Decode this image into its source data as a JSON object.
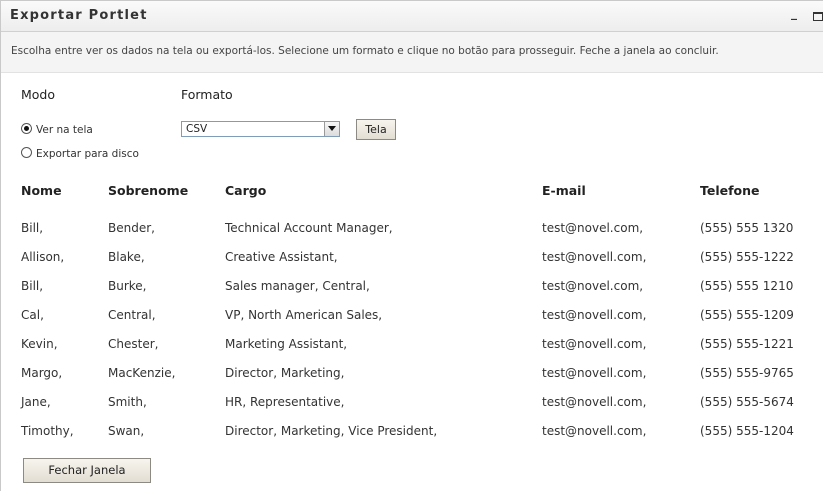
{
  "window": {
    "title": "Exportar Portlet",
    "minimize": "_"
  },
  "intro": "Escolha entre ver os dados na tela ou exportá-los. Selecione um formato e clique no botão para prosseguir. Feche a janela ao concluir.",
  "mode": {
    "label": "Modo",
    "options": [
      {
        "label": "Ver na tela",
        "selected": true
      },
      {
        "label": "Exportar para disco",
        "selected": false
      }
    ]
  },
  "format": {
    "label": "Formato",
    "selected": "CSV",
    "button": "Tela"
  },
  "table": {
    "headers": [
      "Nome",
      "Sobrenome",
      "Cargo",
      "E-mail",
      "Telefone"
    ],
    "rows": [
      [
        "Bill,",
        "Bender,",
        "Technical Account Manager,",
        "test@novel.com,",
        "(555) 555 1320"
      ],
      [
        "Allison,",
        "Blake,",
        "Creative Assistant,",
        "test@novell.com,",
        "(555) 555-1222"
      ],
      [
        "Bill,",
        "Burke,",
        "Sales manager, Central,",
        "test@novel.com,",
        "(555) 555 1210"
      ],
      [
        "Cal,",
        "Central,",
        "VP, North American Sales,",
        "test@novell.com,",
        "(555) 555-1209"
      ],
      [
        "Kevin,",
        "Chester,",
        "Marketing Assistant,",
        "test@novell.com,",
        "(555) 555-1221"
      ],
      [
        "Margo,",
        "MacKenzie,",
        "Director, Marketing,",
        "test@novell.com,",
        "(555) 555-9765"
      ],
      [
        "Jane,",
        "Smith,",
        "HR, Representative,",
        "test@novell.com,",
        "(555) 555-5674"
      ],
      [
        "Timothy,",
        "Swan,",
        "Director, Marketing, Vice President,",
        "test@novell.com,",
        "(555) 555-1204"
      ]
    ]
  },
  "footer": {
    "close_button": "Fechar Janela"
  }
}
